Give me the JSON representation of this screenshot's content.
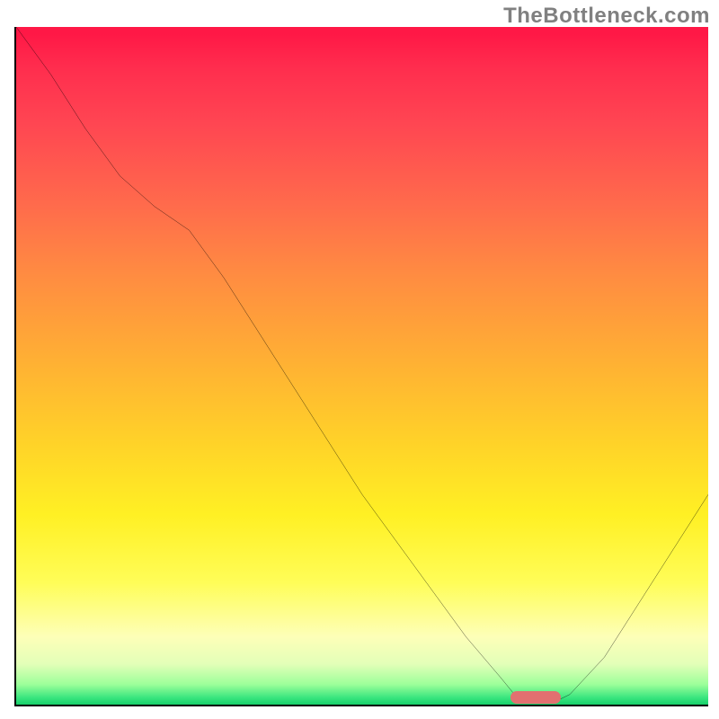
{
  "watermark": "TheBottleneck.com",
  "marker": {
    "color": "#e27070",
    "x_pct": 75,
    "y_pct": 99
  },
  "curve_stroke": "#000000",
  "chart_data": {
    "type": "line",
    "title": "",
    "xlabel": "",
    "ylabel": "",
    "xlim": [
      0,
      100
    ],
    "ylim": [
      0,
      100
    ],
    "x": [
      0,
      5,
      10,
      15,
      20,
      25,
      30,
      35,
      40,
      45,
      50,
      55,
      60,
      65,
      70,
      72,
      75,
      78,
      80,
      85,
      90,
      95,
      100
    ],
    "values": [
      100,
      93,
      85,
      78,
      73.5,
      70,
      63,
      55,
      47,
      39,
      31,
      24,
      17,
      10,
      4,
      1.5,
      0.5,
      0.5,
      1.5,
      7,
      15,
      23,
      31
    ],
    "series": [
      {
        "name": "bottleneck-curve",
        "values": [
          100,
          93,
          85,
          78,
          73.5,
          70,
          63,
          55,
          47,
          39,
          31,
          24,
          17,
          10,
          4,
          1.5,
          0.5,
          0.5,
          1.5,
          7,
          15,
          23,
          31
        ]
      }
    ],
    "annotations": [
      {
        "name": "optimal-marker",
        "x": 75,
        "y": 0.8,
        "color": "#e27070"
      }
    ]
  }
}
